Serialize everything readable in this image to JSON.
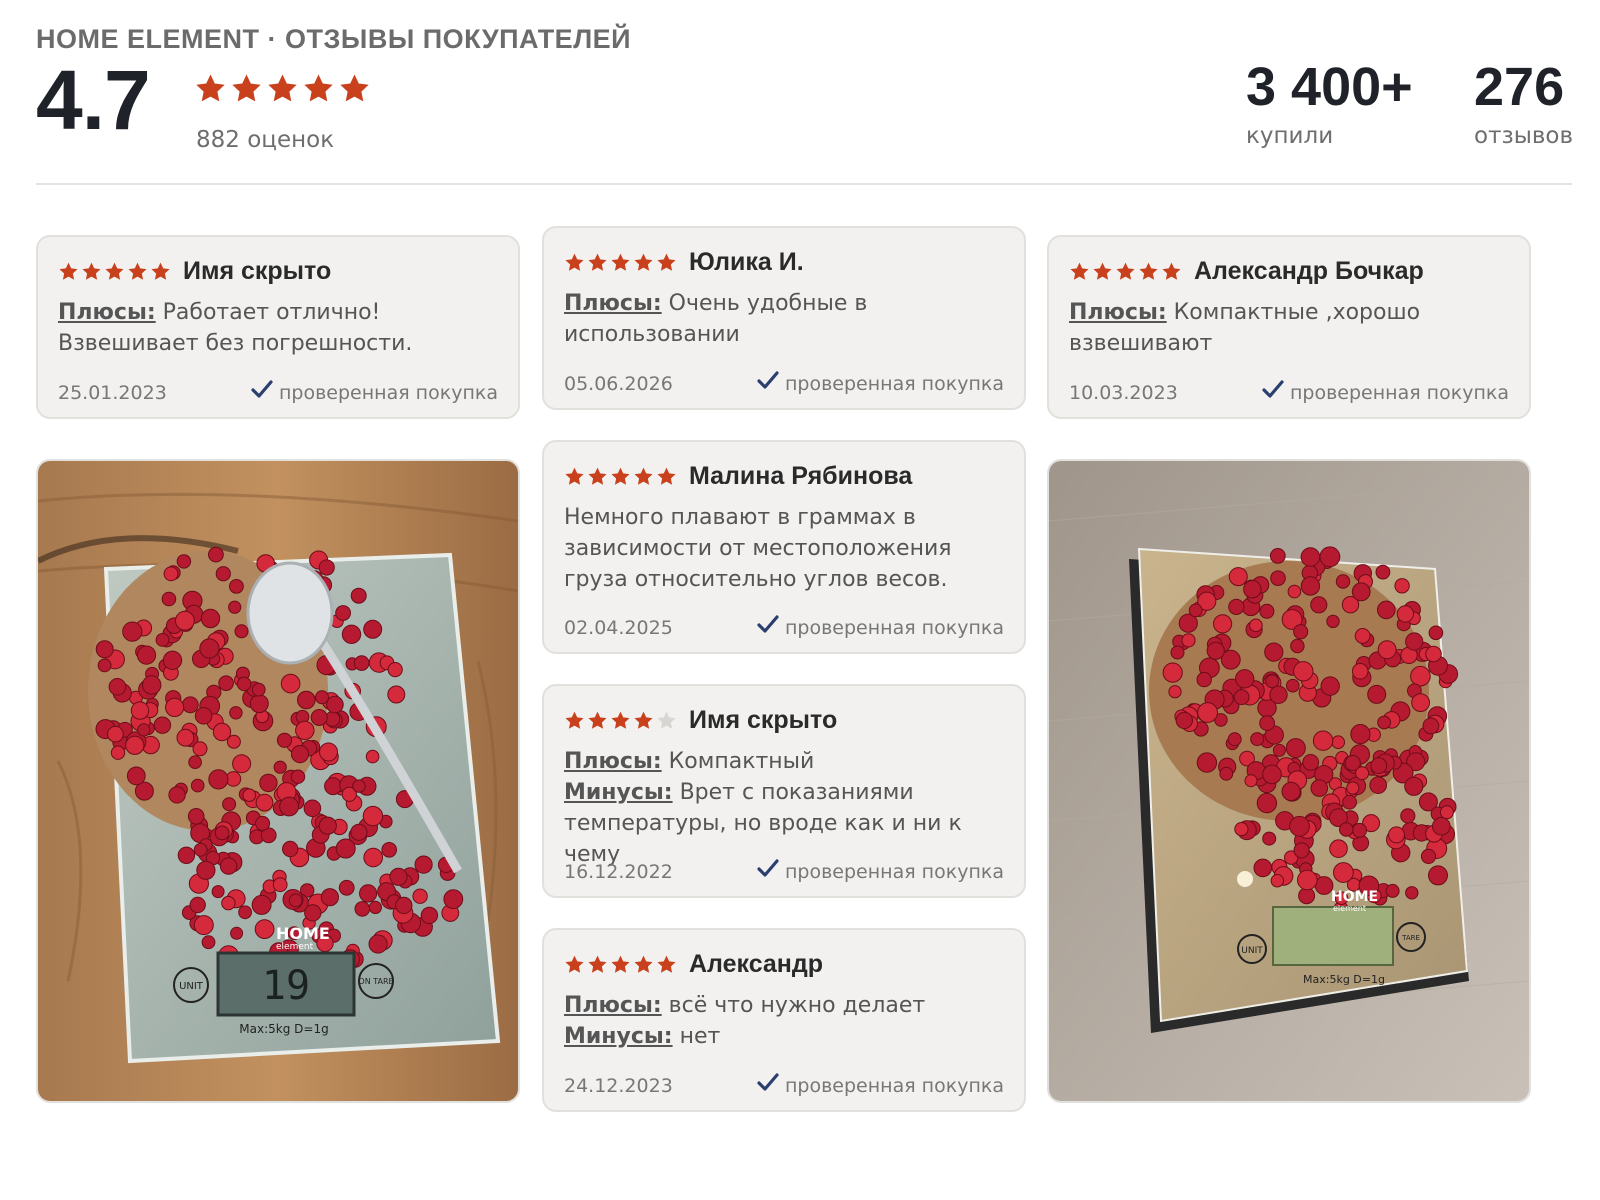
{
  "header": {
    "brand_title": "HOME ELEMENT · ОТЗЫВЫ ПОКУПАТЕЛЕЙ",
    "rating": "4.7",
    "rating_count": "882 оценок",
    "stats": [
      {
        "value": "3 400+",
        "label": "купили"
      },
      {
        "value": "276",
        "label": "отзывов"
      }
    ]
  },
  "colors": {
    "star": "#c8401c",
    "star_empty": "#d8d6d2",
    "check": "#2a3f6e"
  },
  "reviews": [
    {
      "stars": 5,
      "author": "Имя скрыто",
      "pros_label": "Плюсы:",
      "pros": "Работает отлично! Взвешивает без погрешности.",
      "date": "25.01.2023",
      "verified": "проверенная покупка"
    },
    {
      "stars": 5,
      "author": "Юлика И.",
      "pros_label": "Плюсы:",
      "pros": "Очень удобные в использовании",
      "date": "05.06.2026",
      "verified": "проверенная покупка"
    },
    {
      "stars": 5,
      "author": "Александр Бочкар",
      "pros_label": "Плюсы:",
      "pros": "Компактные ,хорошо взвешивают",
      "date": "10.03.2023",
      "verified": "проверенная покупка"
    },
    {
      "stars": 5,
      "author": "Малина Рябинова",
      "text": "Немного плавают в граммах в зависимости от местоположения груза относительно углов весов.",
      "date": "02.04.2025",
      "verified": "проверенная покупка"
    },
    {
      "stars": 4,
      "author": "Имя скрыто",
      "pros_label": "Плюсы:",
      "pros": "Компактный",
      "cons_label": "Минусы:",
      "cons": "Врет с показаниями температуры, но вроде как и ни к чему",
      "date": "16.12.2022",
      "verified": "проверенная покупка"
    },
    {
      "stars": 5,
      "author": "Александр",
      "pros_label": "Плюсы:",
      "pros": "всё что нужно делает",
      "cons_label": "Минусы:",
      "cons": "нет",
      "date": "24.12.2023",
      "verified": "проверенная покупка"
    }
  ],
  "photos": [
    {
      "scale_brand": "HOME",
      "scale_sub": "element",
      "display": "19",
      "unit_btn": "UNIT",
      "tare_btn": "ON TARE",
      "spec": "Max:5kg D=1g"
    },
    {
      "scale_brand": "HOME",
      "scale_sub": "element",
      "unit_btn": "UNIT",
      "tare_btn": "TARE",
      "spec": "Max:5kg D=1g"
    }
  ]
}
